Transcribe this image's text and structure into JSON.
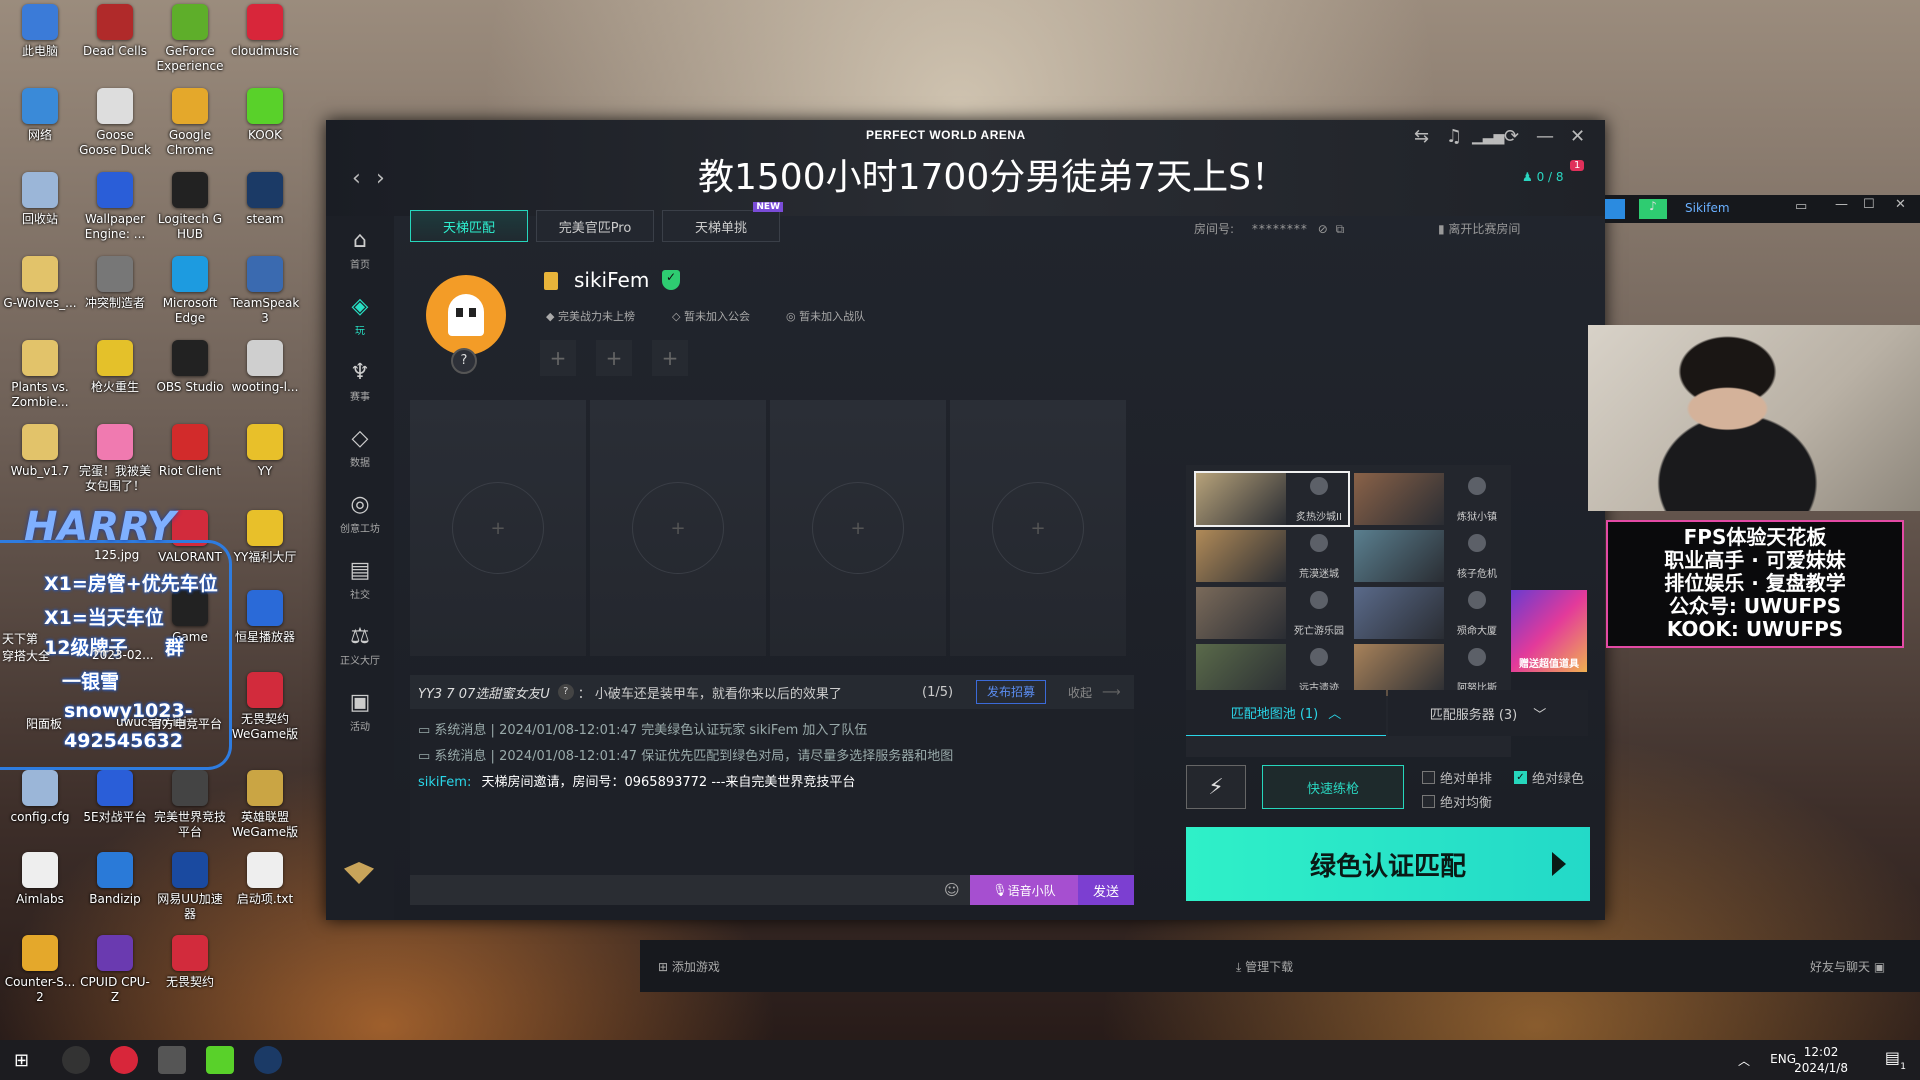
{
  "desktop_icons": [
    {
      "label": "此电脑",
      "color": "#3b7bd8"
    },
    {
      "label": "Dead Cells",
      "color": "#b02a2a"
    },
    {
      "label": "GeForce Experience",
      "color": "#5eae2a"
    },
    {
      "label": "cloudmusic",
      "color": "#d8263a"
    },
    {
      "label": "网络",
      "color": "#3a8ad8"
    },
    {
      "label": "Goose Goose Duck",
      "color": "#ddd"
    },
    {
      "label": "Google Chrome",
      "color": "#e4a82b"
    },
    {
      "label": "KOOK",
      "color": "#59d12a"
    },
    {
      "label": "回收站",
      "color": "#9bb6d8"
    },
    {
      "label": "Wallpaper Engine: ...",
      "color": "#2a5ed8"
    },
    {
      "label": "Logitech G HUB",
      "color": "#222"
    },
    {
      "label": "steam",
      "color": "#1b3a66"
    },
    {
      "label": "G-Wolves_...",
      "color": "#e2c36a"
    },
    {
      "label": "冲突制造者",
      "color": "#777"
    },
    {
      "label": "Microsoft Edge",
      "color": "#1d9be0"
    },
    {
      "label": "TeamSpeak 3",
      "color": "#3a6ab0"
    },
    {
      "label": "Plants vs. Zombie...",
      "color": "#e2c36a"
    },
    {
      "label": "枪火重生",
      "color": "#e4c12a"
    },
    {
      "label": "OBS Studio",
      "color": "#222"
    },
    {
      "label": "wooting-l...",
      "color": "#cfcfcf"
    },
    {
      "label": "Wub_v1.7",
      "color": "#e2c36a"
    },
    {
      "label": "完蛋！我被美女包围了！",
      "color": "#f07ab0"
    },
    {
      "label": "Riot Client",
      "color": "#d22b2b"
    },
    {
      "label": "YY",
      "color": "#e8c02a"
    },
    {
      "label": "VALORANT",
      "color": "#d22b3c"
    },
    {
      "label": "YY福利大厅",
      "color": "#e8c02a"
    },
    {
      "label": "Game",
      "color": "#222"
    },
    {
      "label": "恒星播放器",
      "color": "#2a6ad8"
    },
    {
      "label": "无畏契约 WeGame版",
      "color": "#d22b3c"
    },
    {
      "label": "config.cfg",
      "color": "#9bb6d8"
    },
    {
      "label": "5E对战平台",
      "color": "#2a5ed8"
    },
    {
      "label": "完美世界竞技平台",
      "color": "#444"
    },
    {
      "label": "英雄联盟 WeGame版",
      "color": "#caa544"
    },
    {
      "label": "Aimlabs",
      "color": "#eee"
    },
    {
      "label": "Bandizip",
      "color": "#2a7ad8"
    },
    {
      "label": "网易UU加速器",
      "color": "#1a4aa0"
    },
    {
      "label": "启动项.txt",
      "color": "#eee"
    },
    {
      "label": "Counter-S... 2",
      "color": "#e4a82b"
    },
    {
      "label": "CPUID CPU-Z",
      "color": "#6a3ab0"
    },
    {
      "label": "无畏契约",
      "color": "#d22b3c"
    }
  ],
  "harry_overlay": {
    "name": "HARRY",
    "line1": "X1=房管+优先车位",
    "line2": "X1=当天车位",
    "line3": "12级牌子",
    "line3b": "群",
    "line4": "一银雪",
    "line5": "snowy1023-",
    "line6": "492545632",
    "covered_1": "天下第",
    "covered_2": "穿搭大全",
    "covered_3": "阳面板",
    "covered_4": "125.jpg",
    "covered_5": "2023-02...",
    "covered_6": "uwucsgo.ini",
    "covered_7": "官方电竞平台"
  },
  "client": {
    "brand": "PERFECT WORLD ARENA",
    "stream_title": "教1500小时1700分男徒弟7天上S！",
    "party_count": "0 / 8",
    "notif_count": "1",
    "tabs": [
      {
        "label": "天梯匹配",
        "active": true
      },
      {
        "label": "完美官匹Pro",
        "active": false
      },
      {
        "label": "天梯单挑",
        "active": false,
        "badge": "NEW"
      }
    ],
    "room_label": "房间号:",
    "room_masked": "********",
    "leave_room": "离开比赛房间",
    "sidebar": [
      {
        "label": "首页",
        "icon": "home-icon",
        "glyph": "⌂"
      },
      {
        "label": "玩",
        "icon": "play-icon",
        "glyph": "◈",
        "active": true
      },
      {
        "label": "赛事",
        "icon": "trophy-icon",
        "glyph": "♆"
      },
      {
        "label": "数据",
        "icon": "data-icon",
        "glyph": "◇"
      },
      {
        "label": "创意工坊",
        "icon": "workshop-icon",
        "glyph": "◎"
      },
      {
        "label": "社交",
        "icon": "social-icon",
        "glyph": "▤"
      },
      {
        "label": "正义大厅",
        "icon": "justice-icon",
        "glyph": "⚖"
      },
      {
        "label": "活动",
        "icon": "event-icon",
        "glyph": "▣"
      }
    ],
    "profile": {
      "username": "sikiFem",
      "rank_mark": "?",
      "meta1": "完美战力未上榜",
      "meta2": "暂未加入公会",
      "meta3": "暂未加入战队"
    },
    "chat": {
      "recruit_text": "YY3 7 07选甜蜜女友U",
      "recruit_help": "?",
      "recruit_msg": "： 小破车还是装甲车，就看你来以后的效果了",
      "recruit_page": "(1/5)",
      "recruit_btn": "发布招募",
      "collapse": "收起",
      "sys1": "系统消息 | 2024/01/08-12:01:47 完美绿色认证玩家 sikiFem 加入了队伍",
      "sys2": "系统消息 | 2024/01/08-12:01:47 保证优先匹配到绿色对局，请尽量多选择服务器和地图",
      "msg_user": "sikiFem:",
      "msg_text": "天梯房间邀请，房间号：0965893772 ---来自完美世界竞技平台",
      "voice_btn": "语音小队",
      "send_btn": "发送"
    },
    "maps": [
      {
        "name": "炙热沙城II",
        "thumb": "#b7a27a",
        "selected": true
      },
      {
        "name": "炼狱小镇",
        "thumb": "#8a6248",
        "selected": false
      },
      {
        "name": "荒漠迷城",
        "thumb": "#b08a58",
        "selected": false
      },
      {
        "name": "核子危机",
        "thumb": "#5a7f8f",
        "selected": false
      },
      {
        "name": "死亡游乐园",
        "thumb": "#7a6a5a",
        "selected": false
      },
      {
        "name": "殒命大厦",
        "thumb": "#5a6a8a",
        "selected": false
      },
      {
        "name": "远古遗迹",
        "thumb": "#5a6a4a",
        "selected": false
      },
      {
        "name": "阿努比斯",
        "thumb": "#a8825a",
        "selected": false
      }
    ],
    "promo_side": "赠送超值道具",
    "pool_label": "匹配地图池 (1)",
    "server_label": "匹配服务器 (3)",
    "practice_btn": "快速练枪",
    "chk_solo": "绝对单排",
    "chk_green": "绝对绿色",
    "chk_balance": "绝对均衡",
    "match_btn": "绿色认证匹配"
  },
  "streamer_bar": {
    "name": "Sikifem"
  },
  "promo": {
    "line1": "FPS体验天花板",
    "line2": "职业高手 · 可爱妹妹",
    "line3": "排位娱乐 · 复盘教学",
    "line4": "公众号: UWUFPS",
    "line5": "KOOK: UWUFPS"
  },
  "launcher": {
    "add_game": "添加游戏",
    "manage_dl": "管理下载",
    "friends": "好友与聊天"
  },
  "taskbar": {
    "lang": "ENG",
    "time": "12:02",
    "date": "2024/1/8",
    "notif": "1"
  }
}
